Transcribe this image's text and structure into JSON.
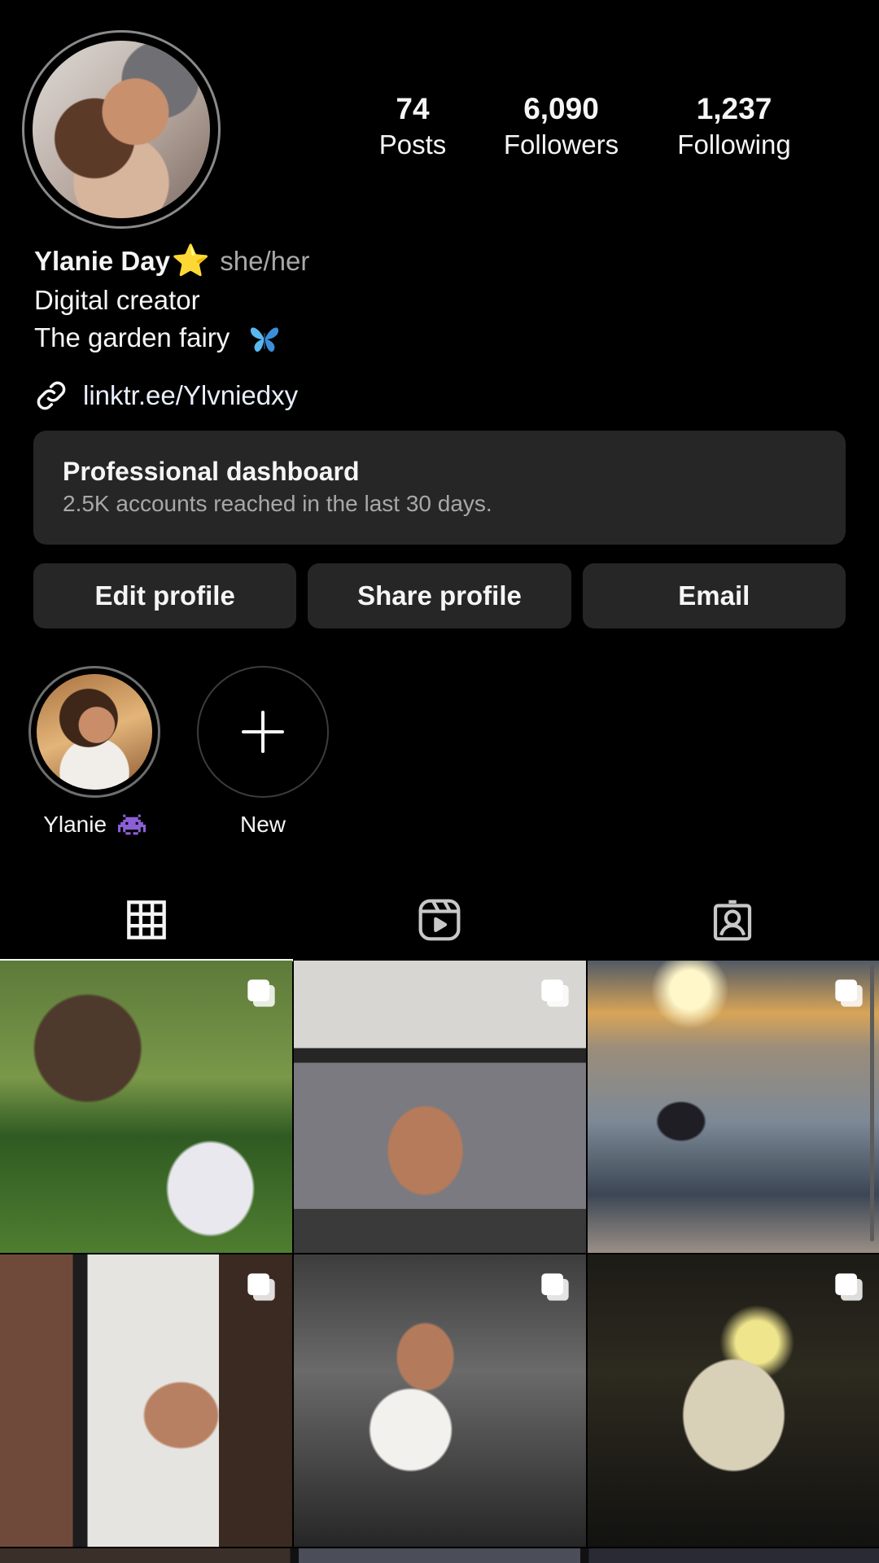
{
  "profile": {
    "name": "Ylanie Day",
    "name_emoji": "⭐",
    "pronouns": "she/her",
    "category": "Digital creator",
    "bio": "The garden fairy",
    "bio_emoji_icon": "butterfly-icon",
    "link": "linktr.ee/Ylvniedxy"
  },
  "stats": {
    "posts": {
      "value": "74",
      "label": "Posts"
    },
    "followers": {
      "value": "6,090",
      "label": "Followers"
    },
    "following": {
      "value": "1,237",
      "label": "Following"
    }
  },
  "dashboard": {
    "title": "Professional dashboard",
    "subtitle": "2.5K accounts reached in the last 30 days."
  },
  "actions": {
    "edit": "Edit profile",
    "share": "Share profile",
    "email": "Email"
  },
  "highlights": [
    {
      "label": "Ylanie",
      "emoji_icon": "space-invader-icon"
    },
    {
      "label": "New",
      "icon": "plus-icon"
    }
  ],
  "tabs": [
    {
      "icon": "grid-icon",
      "active": true
    },
    {
      "icon": "reels-icon",
      "active": false
    },
    {
      "icon": "tagged-icon",
      "active": false
    }
  ],
  "colors": {
    "background": "#000000",
    "surface": "#262626",
    "text": "#f5f5f5",
    "muted": "#a8a8a8",
    "star": "#f6c437",
    "butterfly": "#5ab8f0"
  }
}
